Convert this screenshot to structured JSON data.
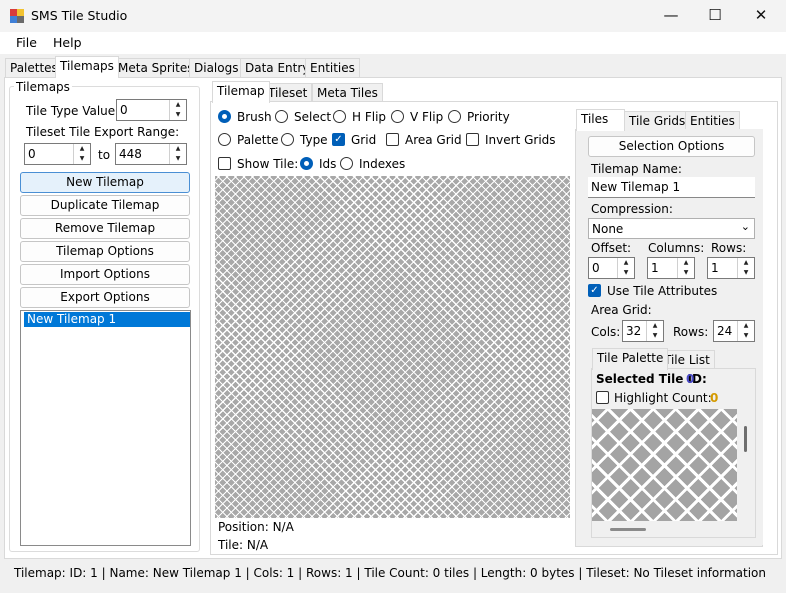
{
  "window": {
    "title": "SMS Tile Studio",
    "minimize": "—",
    "maximize": "☐",
    "close": "✕"
  },
  "menu": [
    "File",
    "Help"
  ],
  "main_tabs": [
    "Palettes",
    "Tilemaps",
    "Meta Sprites",
    "Dialogs",
    "Data Entry",
    "Entities"
  ],
  "left": {
    "group_title": "Tilemaps",
    "tile_type_label": "Tile Type Value:",
    "tile_type_value": "0",
    "export_range_label": "Tileset Tile Export Range:",
    "range_from": "0",
    "range_to_label": "to",
    "range_to": "448",
    "buttons": [
      "New Tilemap",
      "Duplicate Tilemap",
      "Remove Tilemap",
      "Tilemap Options",
      "Import Options",
      "Export Options"
    ],
    "list_items": [
      "New Tilemap 1"
    ]
  },
  "center_tabs": [
    "Tilemap",
    "Tileset",
    "Meta Tiles"
  ],
  "tools": {
    "row1": [
      "Brush",
      "Select",
      "H Flip",
      "V Flip",
      "Priority"
    ],
    "row2_radios": [
      "Palette",
      "Type"
    ],
    "row2_checks": [
      "Grid",
      "Area Grid",
      "Invert Grids"
    ],
    "show_tile": "Show Tile:",
    "row3_radios": [
      "Ids",
      "Indexes"
    ]
  },
  "position": "Position: N/A",
  "tile": "Tile: N/A",
  "right_tabs": [
    "Tiles",
    "Tile Grids",
    "Entities"
  ],
  "right": {
    "selection_options": "Selection Options",
    "tilemap_name_label": "Tilemap Name:",
    "tilemap_name": "New Tilemap 1",
    "compression_label": "Compression:",
    "compression": "None",
    "offset_label": "Offset:",
    "columns_label": "Columns:",
    "rows_label": "Rows:",
    "offset": "0",
    "columns": "1",
    "rows": "1",
    "use_tile_attributes": "Use Tile Attributes",
    "area_grid_label": "Area Grid:",
    "cols_label": "Cols:",
    "cols": "32",
    "rows2_label": "Rows:",
    "rows2": "24",
    "sub_tabs": [
      "Tile Palette",
      "Tile List"
    ],
    "selected_tile_label": "Selected Tile ID:",
    "selected_tile_value": "0",
    "highlight_label": "Highlight Count:",
    "highlight_value": "0"
  },
  "status": "Tilemap: ID: 1 | Name: New Tilemap 1 | Cols: 1 | Rows: 1 | Tile Count: 0 tiles | Length: 0 bytes | Tileset: No Tileset information",
  "colors": {
    "accent": "#005fb8",
    "id_value": "#4a4ac8",
    "highlight_value": "#d49a00",
    "selected_item": "#0078d7"
  }
}
